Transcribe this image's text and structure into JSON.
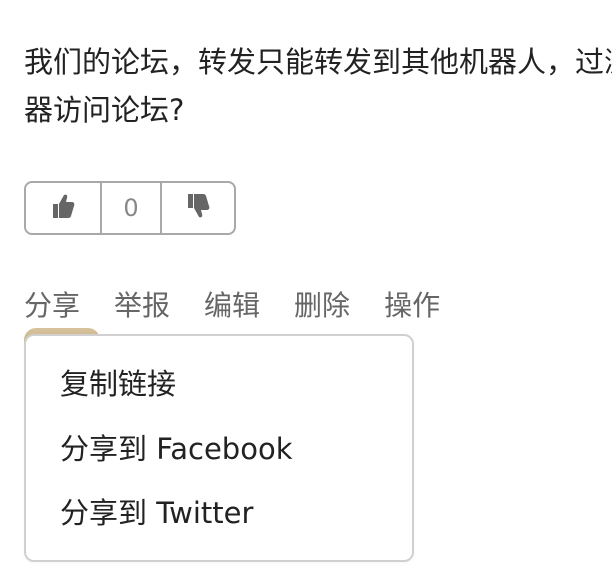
{
  "post": {
    "text": "我们的论坛，转发只能转发到其他机器人，过浏览器访问论坛?"
  },
  "vote": {
    "count": "0",
    "upvote_icon": "thumbs-up-icon",
    "downvote_icon": "thumbs-down-icon"
  },
  "actions": {
    "share": "分享",
    "report": "举报",
    "edit": "编辑",
    "delete": "删除",
    "operate": "操作"
  },
  "share_menu": {
    "items": [
      {
        "label": "复制链接"
      },
      {
        "label": "分享到 Facebook"
      },
      {
        "label": "分享到 Twitter"
      }
    ]
  }
}
